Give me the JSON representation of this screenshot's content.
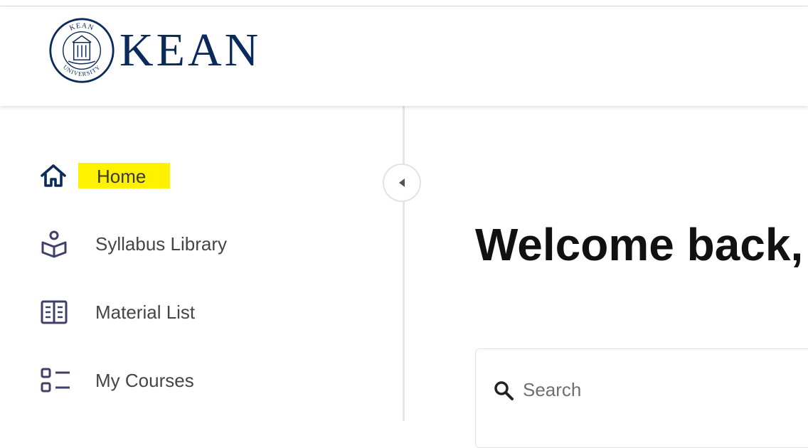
{
  "header": {
    "wordmark": "KEAN",
    "seal_top_text": "KEAN",
    "seal_bottom_text": "UNIVERSITY",
    "brand_color": "#0b2a5c"
  },
  "sidebar": {
    "items": [
      {
        "label": "Home",
        "icon": "home-icon",
        "active": true
      },
      {
        "label": "Syllabus Library",
        "icon": "syllabus-book-icon",
        "active": false
      },
      {
        "label": "Material List",
        "icon": "material-list-icon",
        "active": false
      },
      {
        "label": "My Courses",
        "icon": "courses-list-icon",
        "active": false
      }
    ],
    "highlight_color": "#fff200",
    "icon_color": "#3f3f6b",
    "collapse_icon": "chevron-left-icon"
  },
  "main": {
    "welcome_text": "Welcome back,",
    "search": {
      "placeholder": "Search",
      "icon": "search-icon"
    }
  }
}
